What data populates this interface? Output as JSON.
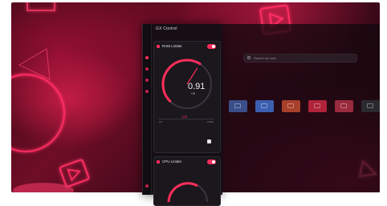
{
  "panel": {
    "title": "GX Control",
    "cards": [
      {
        "title": "RAM Limiter",
        "enabled": true,
        "gauge": {
          "value": "0.91",
          "unit": "GB",
          "level": 0.62
        },
        "range": {
          "min_label": "0.5",
          "max_label": "16GB",
          "current": "1GB"
        }
      },
      {
        "title": "CPU Limiter",
        "enabled": true
      }
    ]
  },
  "main": {
    "search_placeholder": "Search the web",
    "speed_dials": [
      {
        "color": "#3a4e8a"
      },
      {
        "color": "#3b5fb0"
      },
      {
        "color": "#a8402a"
      },
      {
        "color": "#b0233a"
      },
      {
        "color": "#9a2a3e"
      },
      {
        "color": "#2a2a2e"
      }
    ]
  },
  "colors": {
    "accent": "#ff2e5b",
    "panel_bg": "#121014"
  }
}
